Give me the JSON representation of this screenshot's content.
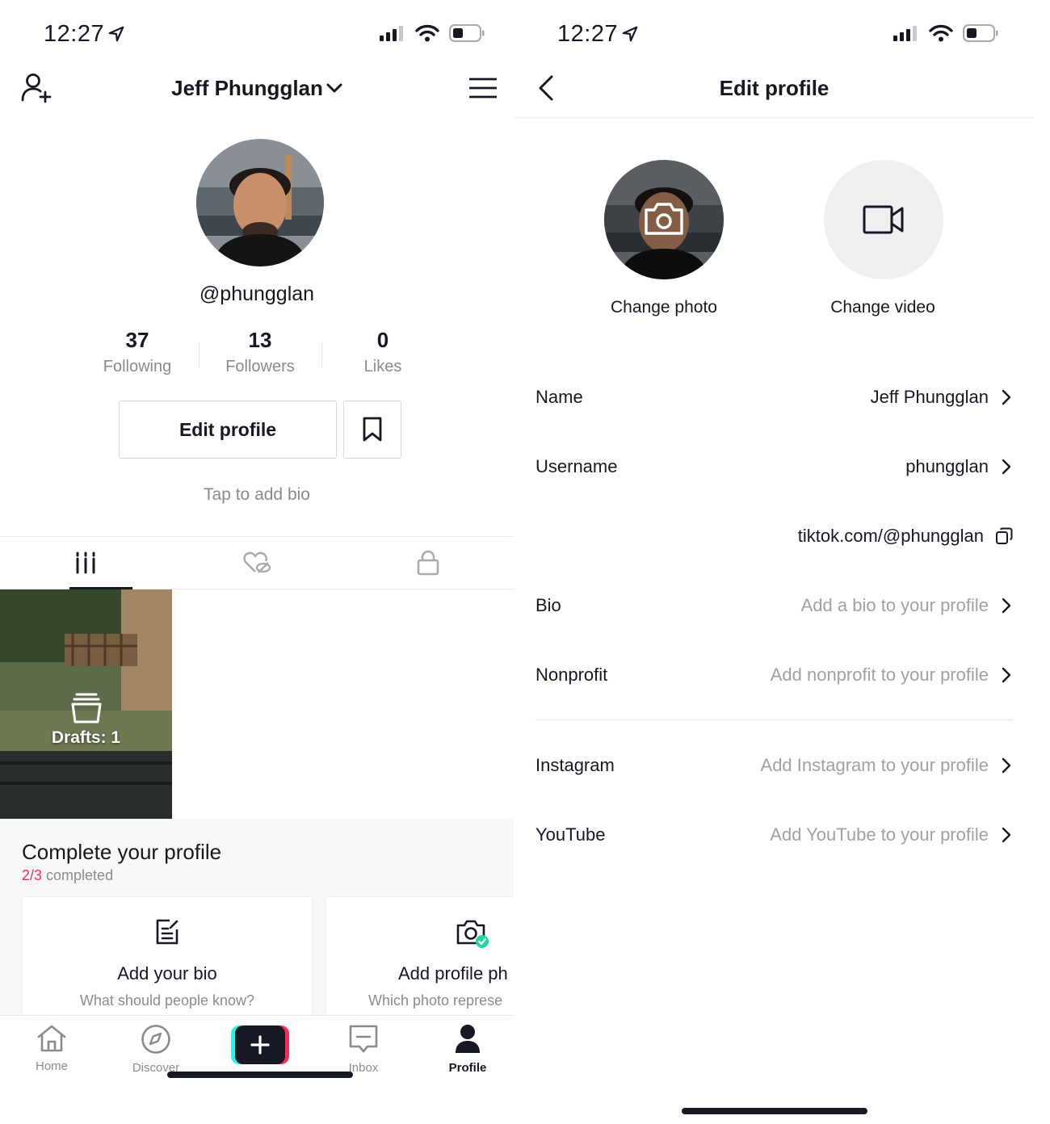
{
  "left": {
    "status": {
      "time": "12:27"
    },
    "header": {
      "title": "Jeff Phungglan"
    },
    "profile": {
      "handle": "@phungglan",
      "stats": [
        {
          "value": "37",
          "label": "Following"
        },
        {
          "value": "13",
          "label": "Followers"
        },
        {
          "value": "0",
          "label": "Likes"
        }
      ],
      "edit_label": "Edit profile",
      "bio_hint": "Tap to add bio"
    },
    "drafts": {
      "label": "Drafts: 1"
    },
    "complete": {
      "title": "Complete your profile",
      "progress": "2/3",
      "progress_suffix": " completed",
      "cards": [
        {
          "title": "Add your bio",
          "sub": "What should people know?"
        },
        {
          "title": "Add profile ph",
          "sub": "Which photo represe"
        }
      ]
    },
    "nav": [
      {
        "label": "Home"
      },
      {
        "label": "Discover"
      },
      {
        "label": "Inbox"
      },
      {
        "label": "Profile"
      }
    ]
  },
  "right": {
    "status": {
      "time": "12:27"
    },
    "header": {
      "title": "Edit profile"
    },
    "change_photo": "Change photo",
    "change_video": "Change video",
    "rows": [
      {
        "label": "Name",
        "value": "Jeff Phungglan"
      },
      {
        "label": "Username",
        "value": "phungglan"
      },
      {
        "label": "",
        "value": "tiktok.com/@phungglan"
      },
      {
        "label": "Bio",
        "value": "Add a bio to your profile"
      },
      {
        "label": "Nonprofit",
        "value": "Add nonprofit to your profile"
      },
      {
        "label": "Instagram",
        "value": "Add Instagram to your profile"
      },
      {
        "label": "YouTube",
        "value": "Add YouTube to your profile"
      }
    ]
  },
  "colors": {
    "accent_red": "#fe2c55",
    "accent_cyan": "#25f4ee",
    "text": "#161823",
    "muted": "#8a8b91"
  }
}
